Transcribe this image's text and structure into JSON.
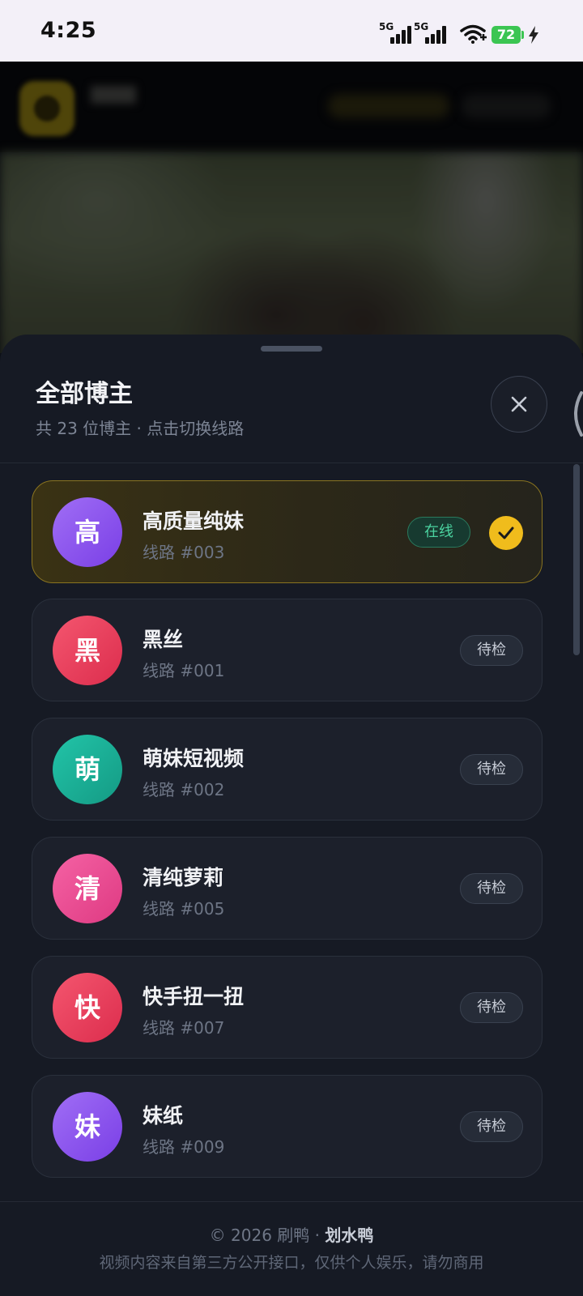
{
  "status_bar": {
    "time": "4:25",
    "network_1": "5G",
    "network_2": "5G",
    "battery": "72",
    "icons": [
      "signal-icon",
      "signal-icon",
      "wifi-icon",
      "battery-icon",
      "charging-bolt-icon"
    ]
  },
  "sheet": {
    "title": "全部博主",
    "subtitle": "共 23 位博主 · 点击切换线路",
    "close_icon": "close-icon"
  },
  "creators": [
    {
      "avatar_char": "高",
      "name": "高质量纯妹",
      "route": "线路 #003",
      "status": "在线",
      "active": true,
      "color": "#8b55f0"
    },
    {
      "avatar_char": "黑",
      "name": "黑丝",
      "route": "线路 #001",
      "status": "待检",
      "active": false,
      "color": "#ee4562"
    },
    {
      "avatar_char": "萌",
      "name": "萌妹短视频",
      "route": "线路 #002",
      "status": "待检",
      "active": false,
      "color": "#1cb39a"
    },
    {
      "avatar_char": "清",
      "name": "清纯萝莉",
      "route": "线路 #005",
      "status": "待检",
      "active": false,
      "color": "#ee4f93"
    },
    {
      "avatar_char": "快",
      "name": "快手扭一扭",
      "route": "线路 #007",
      "status": "待检",
      "active": false,
      "color": "#ee4562"
    },
    {
      "avatar_char": "妹",
      "name": "妹纸",
      "route": "线路 #009",
      "status": "待检",
      "active": false,
      "color": "#8b55f0"
    }
  ],
  "footer": {
    "copyright": "© 2026 刷鸭 · ",
    "brand": "划水鸭",
    "disclaimer": "视频内容来自第三方公开接口，仅供个人娱乐，请勿商用"
  }
}
